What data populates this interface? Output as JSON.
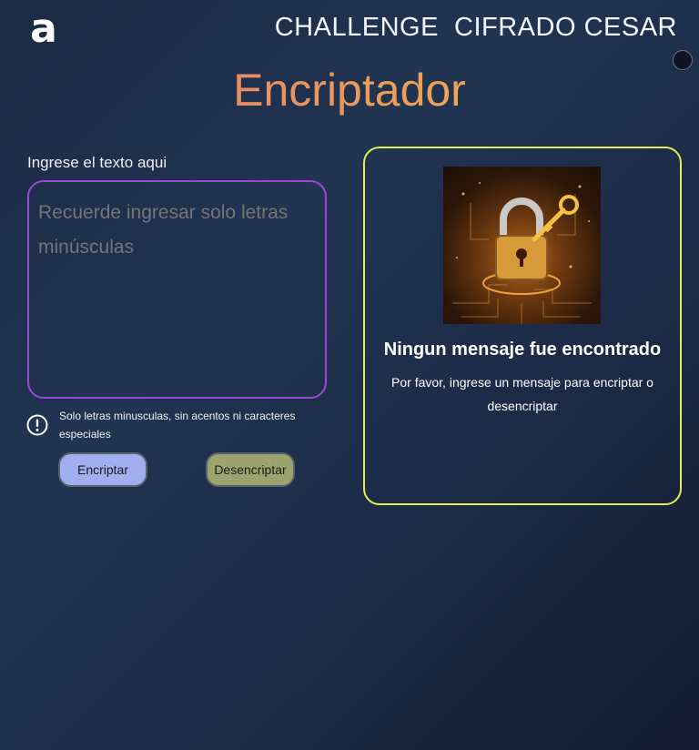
{
  "header": {
    "logo_glyph": "a",
    "title": "CHALLENGE  CIFRADO CESAR"
  },
  "main": {
    "title": "Encriptador",
    "input_label": "Ingrese el texto aqui",
    "input_placeholder": "Recuerde ingresar solo letras minúsculas",
    "hint": "Solo letras minusculas, sin acentos ni caracteres especiales",
    "hint_icon": "exclamation-circle-icon",
    "buttons": {
      "encrypt_label": "Encriptar",
      "decrypt_label": "Desencriptar"
    }
  },
  "result": {
    "image": "padlock-with-key-illustration",
    "title": "Ningun mensaje fue encontrado",
    "text": "Por favor, ingrese un mensaje para encriptar o desencriptar"
  },
  "colors": {
    "textarea_border": "#9d47d8",
    "result_border": "#e0f050",
    "encrypt_button": "#a1aef0",
    "decrypt_button": "#9da36e"
  }
}
